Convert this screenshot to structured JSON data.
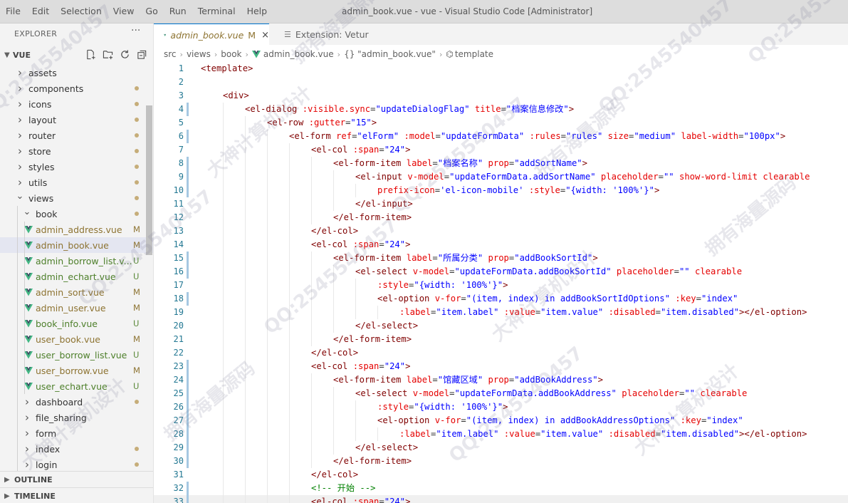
{
  "menu": [
    "File",
    "Edit",
    "Selection",
    "View",
    "Go",
    "Run",
    "Terminal",
    "Help"
  ],
  "window_title": "admin_book.vue - vue - Visual Studio Code [Administrator]",
  "sidebar": {
    "header": "EXPLORER",
    "more": "···",
    "root": "VUE",
    "actions": [
      "new-file-icon",
      "new-folder-icon",
      "refresh-icon",
      "collapse-all-icon"
    ],
    "tree": [
      {
        "name": "assets",
        "type": "folder",
        "depth": 1,
        "open": false,
        "dot": false
      },
      {
        "name": "components",
        "type": "folder",
        "depth": 1,
        "open": false,
        "dot": true
      },
      {
        "name": "icons",
        "type": "folder",
        "depth": 1,
        "open": false,
        "dot": true
      },
      {
        "name": "layout",
        "type": "folder",
        "depth": 1,
        "open": false,
        "dot": true
      },
      {
        "name": "router",
        "type": "folder",
        "depth": 1,
        "open": false,
        "dot": true
      },
      {
        "name": "store",
        "type": "folder",
        "depth": 1,
        "open": false,
        "dot": true
      },
      {
        "name": "styles",
        "type": "folder",
        "depth": 1,
        "open": false,
        "dot": true
      },
      {
        "name": "utils",
        "type": "folder",
        "depth": 1,
        "open": false,
        "dot": true
      },
      {
        "name": "views",
        "type": "folder",
        "depth": 1,
        "open": true,
        "dot": true
      },
      {
        "name": "book",
        "type": "folder",
        "depth": 2,
        "open": true,
        "dot": true
      },
      {
        "name": "admin_address.vue",
        "type": "vue",
        "depth": 3,
        "status": "M"
      },
      {
        "name": "admin_book.vue",
        "type": "vue",
        "depth": 3,
        "status": "M",
        "selected": true
      },
      {
        "name": "admin_borrow_list.v...",
        "type": "vue",
        "depth": 3,
        "status": "U"
      },
      {
        "name": "admin_echart.vue",
        "type": "vue",
        "depth": 3,
        "status": "U"
      },
      {
        "name": "admin_sort.vue",
        "type": "vue",
        "depth": 3,
        "status": "M"
      },
      {
        "name": "admin_user.vue",
        "type": "vue",
        "depth": 3,
        "status": "M"
      },
      {
        "name": "book_info.vue",
        "type": "vue",
        "depth": 3,
        "status": "U"
      },
      {
        "name": "user_book.vue",
        "type": "vue",
        "depth": 3,
        "status": "M"
      },
      {
        "name": "user_borrow_list.vue",
        "type": "vue",
        "depth": 3,
        "status": "U"
      },
      {
        "name": "user_borrow.vue",
        "type": "vue",
        "depth": 3,
        "status": "M"
      },
      {
        "name": "user_echart.vue",
        "type": "vue",
        "depth": 3,
        "status": "U"
      },
      {
        "name": "dashboard",
        "type": "folder",
        "depth": 2,
        "open": false,
        "dot": true
      },
      {
        "name": "file_sharing",
        "type": "folder",
        "depth": 2,
        "open": false,
        "dot": false
      },
      {
        "name": "form",
        "type": "folder",
        "depth": 2,
        "open": false,
        "dot": false
      },
      {
        "name": "index",
        "type": "folder",
        "depth": 2,
        "open": false,
        "dot": true
      },
      {
        "name": "login",
        "type": "folder",
        "depth": 2,
        "open": false,
        "dot": true
      }
    ],
    "sections": [
      "OUTLINE",
      "TIMELINE"
    ]
  },
  "tabs": [
    {
      "label": "admin_book.vue",
      "badge": "M",
      "close": "×",
      "active": true
    },
    {
      "label": "Extension: Vetur",
      "active": false
    }
  ],
  "breadcrumb": [
    "src",
    "views",
    "book",
    "admin_book.vue",
    "{} \"admin_book.vue\"",
    "template"
  ],
  "code_lines": [
    {
      "n": 1,
      "indent": 0,
      "tokens": [
        [
          "tag",
          "<template>"
        ]
      ]
    },
    {
      "n": 2,
      "indent": 0,
      "tokens": []
    },
    {
      "n": 3,
      "indent": 1,
      "tokens": [
        [
          "tag",
          "<div>"
        ]
      ]
    },
    {
      "n": 4,
      "indent": 2,
      "mark": true,
      "tokens": [
        [
          "tag",
          "<el-dialog "
        ],
        [
          "attr",
          ":visible.sync"
        ],
        [
          "pun",
          "="
        ],
        [
          "str",
          "\"updateDialogFlag\""
        ],
        [
          "pun",
          " "
        ],
        [
          "attr",
          "title"
        ],
        [
          "pun",
          "="
        ],
        [
          "str",
          "\"档案信息修改\""
        ],
        [
          "tag",
          ">"
        ]
      ]
    },
    {
      "n": 5,
      "indent": 3,
      "tokens": [
        [
          "tag",
          "<el-row "
        ],
        [
          "attr",
          ":gutter"
        ],
        [
          "pun",
          "="
        ],
        [
          "str",
          "\"15\""
        ],
        [
          "tag",
          ">"
        ]
      ]
    },
    {
      "n": 6,
      "indent": 4,
      "mark": true,
      "tokens": [
        [
          "tag",
          "<el-form "
        ],
        [
          "attr",
          "ref"
        ],
        [
          "pun",
          "="
        ],
        [
          "str",
          "\"elForm\""
        ],
        [
          "pun",
          " "
        ],
        [
          "attr",
          ":model"
        ],
        [
          "pun",
          "="
        ],
        [
          "str",
          "\"updateFormData\""
        ],
        [
          "pun",
          " "
        ],
        [
          "attr",
          ":rules"
        ],
        [
          "pun",
          "="
        ],
        [
          "str",
          "\"rules\""
        ],
        [
          "pun",
          " "
        ],
        [
          "attr",
          "size"
        ],
        [
          "pun",
          "="
        ],
        [
          "str",
          "\"medium\""
        ],
        [
          "pun",
          " "
        ],
        [
          "attr",
          "label-width"
        ],
        [
          "pun",
          "="
        ],
        [
          "str",
          "\"100px\""
        ],
        [
          "tag",
          ">"
        ]
      ]
    },
    {
      "n": 7,
      "indent": 5,
      "tokens": [
        [
          "tag",
          "<el-col "
        ],
        [
          "attr",
          ":span"
        ],
        [
          "pun",
          "="
        ],
        [
          "str",
          "\"24\""
        ],
        [
          "tag",
          ">"
        ]
      ]
    },
    {
      "n": 8,
      "indent": 6,
      "mark": true,
      "tokens": [
        [
          "tag",
          "<el-form-item "
        ],
        [
          "attr",
          "label"
        ],
        [
          "pun",
          "="
        ],
        [
          "str",
          "\"档案名称\""
        ],
        [
          "pun",
          " "
        ],
        [
          "attr",
          "prop"
        ],
        [
          "pun",
          "="
        ],
        [
          "str",
          "\"addSortName\""
        ],
        [
          "tag",
          ">"
        ]
      ]
    },
    {
      "n": 9,
      "indent": 7,
      "mark": true,
      "tokens": [
        [
          "tag",
          "<el-input "
        ],
        [
          "attr",
          "v-model"
        ],
        [
          "pun",
          "="
        ],
        [
          "str",
          "\"updateFormData.addSortName\""
        ],
        [
          "pun",
          " "
        ],
        [
          "attr",
          "placeholder"
        ],
        [
          "pun",
          "="
        ],
        [
          "str",
          "\"\""
        ],
        [
          "pun",
          " "
        ],
        [
          "attr",
          "show-word-limit"
        ],
        [
          "pun",
          " "
        ],
        [
          "attr",
          "clearable"
        ]
      ]
    },
    {
      "n": 10,
      "indent": 8,
      "mark": true,
      "tokens": [
        [
          "attr",
          "prefix-icon"
        ],
        [
          "pun",
          "="
        ],
        [
          "str",
          "'el-icon-mobile'"
        ],
        [
          "pun",
          " "
        ],
        [
          "attr",
          ":style"
        ],
        [
          "pun",
          "="
        ],
        [
          "str",
          "\"{width: '100%'}\""
        ],
        [
          "tag",
          ">"
        ]
      ]
    },
    {
      "n": 11,
      "indent": 7,
      "tokens": [
        [
          "tag",
          "</el-input>"
        ]
      ]
    },
    {
      "n": 12,
      "indent": 6,
      "tokens": [
        [
          "tag",
          "</el-form-item>"
        ]
      ]
    },
    {
      "n": 13,
      "indent": 5,
      "tokens": [
        [
          "tag",
          "</el-col>"
        ]
      ]
    },
    {
      "n": 14,
      "indent": 5,
      "tokens": [
        [
          "tag",
          "<el-col "
        ],
        [
          "attr",
          ":span"
        ],
        [
          "pun",
          "="
        ],
        [
          "str",
          "\"24\""
        ],
        [
          "tag",
          ">"
        ]
      ]
    },
    {
      "n": 15,
      "indent": 6,
      "mark": true,
      "tokens": [
        [
          "tag",
          "<el-form-item "
        ],
        [
          "attr",
          "label"
        ],
        [
          "pun",
          "="
        ],
        [
          "str",
          "\"所属分类\""
        ],
        [
          "pun",
          " "
        ],
        [
          "attr",
          "prop"
        ],
        [
          "pun",
          "="
        ],
        [
          "str",
          "\"addBookSortId\""
        ],
        [
          "tag",
          ">"
        ]
      ]
    },
    {
      "n": 16,
      "indent": 7,
      "mark": true,
      "tokens": [
        [
          "tag",
          "<el-select "
        ],
        [
          "attr",
          "v-model"
        ],
        [
          "pun",
          "="
        ],
        [
          "str",
          "\"updateFormData.addBookSortId\""
        ],
        [
          "pun",
          " "
        ],
        [
          "attr",
          "placeholder"
        ],
        [
          "pun",
          "="
        ],
        [
          "str",
          "\"\""
        ],
        [
          "pun",
          " "
        ],
        [
          "attr",
          "clearable"
        ]
      ]
    },
    {
      "n": 17,
      "indent": 8,
      "tokens": [
        [
          "attr",
          ":style"
        ],
        [
          "pun",
          "="
        ],
        [
          "str",
          "\"{width: '100%'}\""
        ],
        [
          "tag",
          ">"
        ]
      ]
    },
    {
      "n": 18,
      "indent": 8,
      "mark": true,
      "tokens": [
        [
          "tag",
          "<el-option "
        ],
        [
          "attr",
          "v-for"
        ],
        [
          "pun",
          "="
        ],
        [
          "str",
          "\"(item, index) in addBookSortIdOptions\""
        ],
        [
          "pun",
          " "
        ],
        [
          "attr",
          ":key"
        ],
        [
          "pun",
          "="
        ],
        [
          "str",
          "\"index\""
        ]
      ]
    },
    {
      "n": 19,
      "indent": 9,
      "tokens": [
        [
          "attr",
          ":label"
        ],
        [
          "pun",
          "="
        ],
        [
          "str",
          "\"item.label\""
        ],
        [
          "pun",
          " "
        ],
        [
          "attr",
          ":value"
        ],
        [
          "pun",
          "="
        ],
        [
          "str",
          "\"item.value\""
        ],
        [
          "pun",
          " "
        ],
        [
          "attr",
          ":disabled"
        ],
        [
          "pun",
          "="
        ],
        [
          "str",
          "\"item.disabled\""
        ],
        [
          "tag",
          "></el-option>"
        ]
      ]
    },
    {
      "n": 20,
      "indent": 7,
      "tokens": [
        [
          "tag",
          "</el-select>"
        ]
      ]
    },
    {
      "n": 21,
      "indent": 6,
      "tokens": [
        [
          "tag",
          "</el-form-item>"
        ]
      ]
    },
    {
      "n": 22,
      "indent": 5,
      "tokens": [
        [
          "tag",
          "</el-col>"
        ]
      ]
    },
    {
      "n": 23,
      "indent": 5,
      "mark": true,
      "tokens": [
        [
          "tag",
          "<el-col "
        ],
        [
          "attr",
          ":span"
        ],
        [
          "pun",
          "="
        ],
        [
          "str",
          "\"24\""
        ],
        [
          "tag",
          ">"
        ]
      ]
    },
    {
      "n": 24,
      "indent": 6,
      "mark": true,
      "tokens": [
        [
          "tag",
          "<el-form-item "
        ],
        [
          "attr",
          "label"
        ],
        [
          "pun",
          "="
        ],
        [
          "str",
          "\"馆藏区域\""
        ],
        [
          "pun",
          " "
        ],
        [
          "attr",
          "prop"
        ],
        [
          "pun",
          "="
        ],
        [
          "str",
          "\"addBookAddress\""
        ],
        [
          "tag",
          ">"
        ]
      ]
    },
    {
      "n": 25,
      "indent": 7,
      "mark": true,
      "tokens": [
        [
          "tag",
          "<el-select "
        ],
        [
          "attr",
          "v-model"
        ],
        [
          "pun",
          "="
        ],
        [
          "str",
          "\"updateFormData.addBookAddress\""
        ],
        [
          "pun",
          " "
        ],
        [
          "attr",
          "placeholder"
        ],
        [
          "pun",
          "="
        ],
        [
          "str",
          "\"\""
        ],
        [
          "pun",
          " "
        ],
        [
          "attr",
          "clearable"
        ]
      ]
    },
    {
      "n": 26,
      "indent": 8,
      "mark": true,
      "tokens": [
        [
          "attr",
          ":style"
        ],
        [
          "pun",
          "="
        ],
        [
          "str",
          "\"{width: '100%'}\""
        ],
        [
          "tag",
          ">"
        ]
      ]
    },
    {
      "n": 27,
      "indent": 8,
      "mark": true,
      "tokens": [
        [
          "tag",
          "<el-option "
        ],
        [
          "attr",
          "v-for"
        ],
        [
          "pun",
          "="
        ],
        [
          "str",
          "\"(item, index) in addBookAddressOptions\""
        ],
        [
          "pun",
          " "
        ],
        [
          "attr",
          ":key"
        ],
        [
          "pun",
          "="
        ],
        [
          "str",
          "\"index\""
        ]
      ]
    },
    {
      "n": 28,
      "indent": 9,
      "mark": true,
      "tokens": [
        [
          "attr",
          ":label"
        ],
        [
          "pun",
          "="
        ],
        [
          "str",
          "\"item.label\""
        ],
        [
          "pun",
          " "
        ],
        [
          "attr",
          ":value"
        ],
        [
          "pun",
          "="
        ],
        [
          "str",
          "\"item.value\""
        ],
        [
          "pun",
          " "
        ],
        [
          "attr",
          ":disabled"
        ],
        [
          "pun",
          "="
        ],
        [
          "str",
          "\"item.disabled\""
        ],
        [
          "tag",
          "></el-option>"
        ]
      ]
    },
    {
      "n": 29,
      "indent": 7,
      "mark": true,
      "tokens": [
        [
          "tag",
          "</el-select>"
        ]
      ]
    },
    {
      "n": 30,
      "indent": 6,
      "mark": true,
      "tokens": [
        [
          "tag",
          "</el-form-item>"
        ]
      ]
    },
    {
      "n": 31,
      "indent": 5,
      "tokens": [
        [
          "tag",
          "</el-col>"
        ]
      ]
    },
    {
      "n": 32,
      "indent": 5,
      "mark": true,
      "tokens": [
        [
          "cmt",
          "<!-- 开始 -->"
        ]
      ]
    },
    {
      "n": 33,
      "indent": 5,
      "mark": true,
      "current": true,
      "tokens": [
        [
          "tag",
          "<el-col "
        ],
        [
          "attr",
          ":span"
        ],
        [
          "pun",
          "="
        ],
        [
          "str",
          "\"24\""
        ],
        [
          "tag",
          ">"
        ]
      ]
    }
  ],
  "watermark": {
    "lines": [
      "QQ:2545540457",
      "大神计算机设计",
      "拥有海量源码"
    ]
  },
  "colors": {
    "accent": "#0078d4",
    "modified": "#8d7331",
    "untracked": "#4d7f2a",
    "vue_green": "#41b883",
    "vue_dark": "#35495e"
  }
}
